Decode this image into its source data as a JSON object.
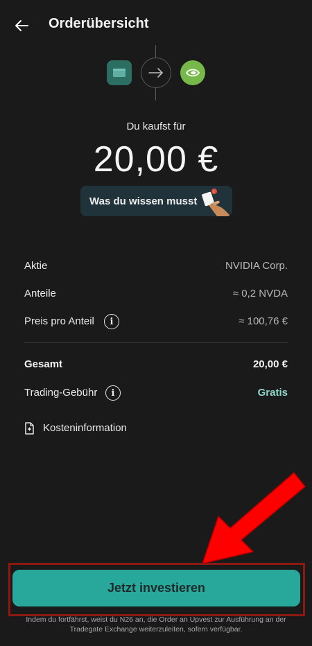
{
  "header": {
    "title": "Orderübersicht",
    "back_icon": "arrow-left-icon"
  },
  "flow": {
    "from_icon": "cash-icon",
    "arrow_icon": "arrow-right-icon",
    "to_icon": "nvidia-logo"
  },
  "purchase": {
    "label": "Du kaufst für",
    "amount": "20,00 €"
  },
  "info_button": {
    "label": "Was du wissen musst",
    "illustration": "hand-cards-icon"
  },
  "details": [
    {
      "label": "Aktie",
      "value": "NVIDIA Corp."
    },
    {
      "label": "Anteile",
      "value": "≈ 0,2 NVDA"
    },
    {
      "label": "Preis pro Anteil",
      "value": "≈ 100,76 €"
    }
  ],
  "summary": {
    "total_label": "Gesamt",
    "total_value": "20,00 €",
    "fee_label": "Trading-Gebühr",
    "fee_value": "Gratis"
  },
  "cost_info": {
    "label": "Kosteninformation",
    "icon": "document-icon"
  },
  "cta": {
    "label": "Jetzt investieren"
  },
  "disclaimer": "Indem du fortfährst, weist du N26 an, die Order an Upvest zur Ausführung an der Tradegate Exchange weiterzuleiten, sofern verfügbar.",
  "colors": {
    "background": "#1a1a1a",
    "accent": "#28a79b",
    "accent_text": "#8fd5cb",
    "highlight_frame": "#8c1a12",
    "annotation_arrow": "#ff0000"
  }
}
